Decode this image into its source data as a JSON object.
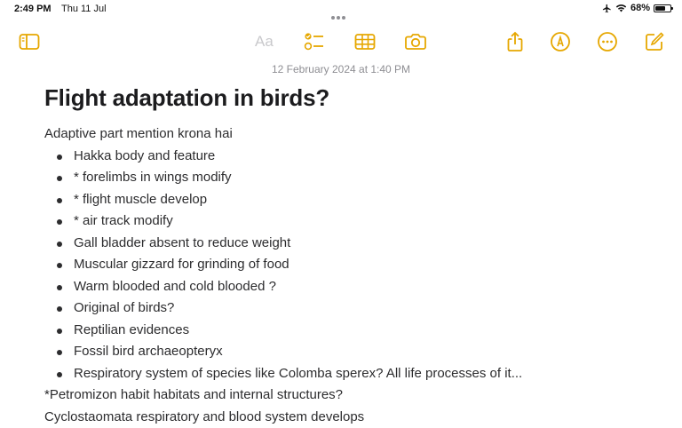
{
  "status_bar": {
    "time": "2:49 PM",
    "date": "Thu 11 Jul",
    "battery_text": "68%",
    "battery_level": 0.68
  },
  "toolbar": {
    "text_format_label": "Aa",
    "accent_color": "#e6a700",
    "icons": [
      "sidebar-icon",
      "checklist-icon",
      "table-icon",
      "camera-icon",
      "share-icon",
      "markup-icon",
      "more-icon",
      "compose-icon"
    ]
  },
  "note": {
    "timestamp": "12 February 2024 at 1:40 PM",
    "title": "Flight adaptation in birds?",
    "intro": "Adaptive part mention krona hai",
    "bullets": [
      "Hakka body and feature",
      "* forelimbs in wings modify",
      "* flight muscle develop",
      "* air track modify",
      "Gall bladder absent to reduce weight",
      "Muscular gizzard for grinding of food",
      "Warm blooded and cold blooded ?",
      "Original of birds?",
      "Reptilian evidences",
      "Fossil bird archaeopteryx",
      "Respiratory system of species like Colomba sperex? All life processes of it..."
    ],
    "after_lines": [
      "*Petromizon habit habitats and internal structures?",
      "Cyclostaomata respiratory and blood system develops"
    ]
  }
}
